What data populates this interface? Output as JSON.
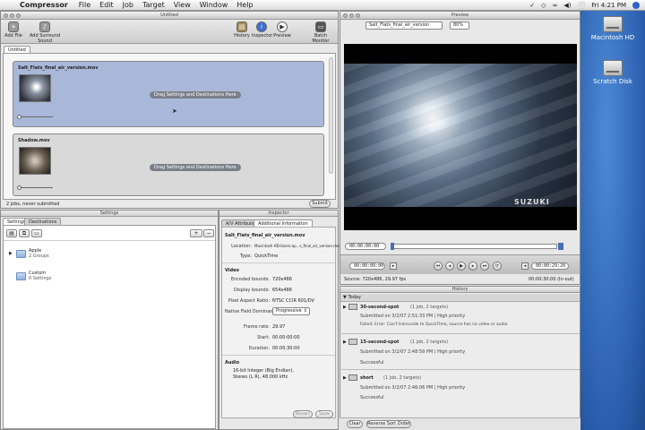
{
  "menubar": {
    "apple": "",
    "app": "Compressor",
    "items": [
      "File",
      "Edit",
      "Job",
      "Target",
      "View",
      "Window",
      "Help"
    ],
    "clock": "Fri 4:21 PM",
    "status_glyphs": [
      "✓",
      "◇",
      "≈",
      "◀)",
      "⬜"
    ]
  },
  "desktop": {
    "disks": [
      "Macintosh HD",
      "Scratch Disk"
    ]
  },
  "batch": {
    "title": "Untitled",
    "toolbar": {
      "add_file": "Add File",
      "add_surround": "Add Surround Sound",
      "history": "History",
      "inspector": "Inspector",
      "preview": "Preview",
      "batch_monitor": "Batch Monitor"
    },
    "tab": "Untitled",
    "jobs": [
      {
        "name": "Salt_Flats_final_air_version.mov",
        "drag": "Drag Settings and Destinations Here"
      },
      {
        "name": "Shadow.mov",
        "drag": "Drag Settings and Destinations Here"
      }
    ],
    "status": "2 jobs, never submitted",
    "submit": "Submit"
  },
  "settings": {
    "title": "Settings",
    "tabs": [
      "Settings",
      "Destinations"
    ],
    "add": "+",
    "remove": "−",
    "folders": [
      {
        "name": "Apple",
        "sub": "2 Groups"
      },
      {
        "name": "Custom",
        "sub": "0 Settings"
      }
    ]
  },
  "inspector": {
    "title": "Inspector",
    "tabs": [
      "A/V Attributes",
      "Additional Information"
    ],
    "filename": "Salt_Flats_final_air_version.mov",
    "location_label": "Location:",
    "location": "Macintosh HD:Users:ap...s_final_air_version.mov",
    "type_label": "Type:",
    "type": "QuickTime",
    "video_header": "Video",
    "encoded_label": "Encoded bounds:",
    "encoded": "720x486",
    "display_label": "Display bounds:",
    "display": "654x486",
    "par_label": "Pixel Aspect Ratio:",
    "par": "NTSC CCIR 601/DV",
    "nfd_label": "Native Field Dominance:",
    "nfd": "Progressive",
    "fr_label": "Frame rate:",
    "fr": "29.97",
    "start_label": "Start:",
    "start": "00:00:00:00",
    "dur_label": "Duration:",
    "dur": "00:00:30:00",
    "audio_header": "Audio",
    "audio_line1": "16-bit Integer (Big Endian),",
    "audio_line2": "Stereo (L R), 48.000 kHz",
    "revert": "Revert",
    "save": "Save"
  },
  "preview": {
    "title": "Preview",
    "source": "Salt_Flats_final_air_version",
    "zoom": "80%",
    "watermark": "SUZUKI",
    "tc_current": "00:00:00:00",
    "tc_in": "00:00:00:00",
    "tc_out": "00:00:29:20",
    "source_info": "Source: 720x486, 29.97 fps",
    "duration_info": "00:00:30:00 (In-out)"
  },
  "history": {
    "title": "History",
    "group": "Today",
    "items": [
      {
        "name": "30-second-spot",
        "meta": "(1 job, 2 targets)",
        "submitted": "Submitted on 3/2/07 2:51:33 PM  |  High priority",
        "result": "Failed: Error: Can't transcode to QuickTime, source has no video or audio"
      },
      {
        "name": "15-second-spot",
        "meta": "(1 job, 2 targets)",
        "submitted": "Submitted on 3/2/07 2:48:59 PM  |  High priority",
        "result": "Successful"
      },
      {
        "name": "short",
        "meta": "(1 job, 2 targets)",
        "submitted": "Submitted on 3/2/07 2:46:06 PM  |  High priority",
        "result": "Successful"
      }
    ],
    "clear": "Clear",
    "reverse": "Reverse Sort Order"
  },
  "colors": {
    "job_selected": "#a9b7d9",
    "job_normal": "#d9d9d9",
    "desktop": "#2f63b0",
    "video_bg": "#000000"
  }
}
